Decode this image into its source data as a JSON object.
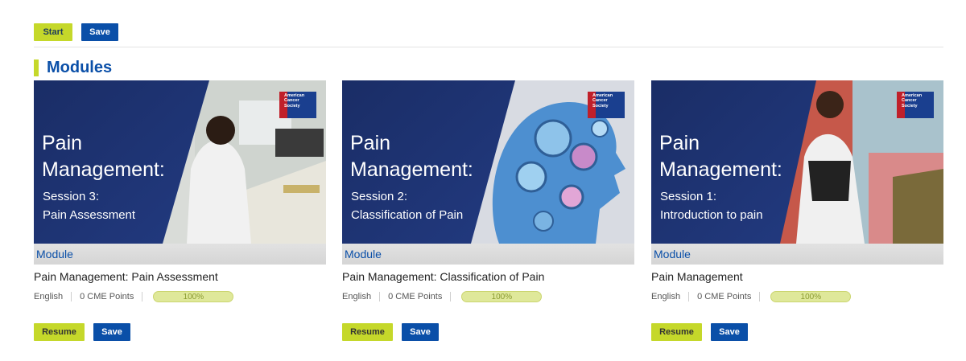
{
  "toolbar": {
    "start_label": "Start",
    "save_label": "Save"
  },
  "section": {
    "title": "Modules"
  },
  "cards": [
    {
      "thumb_title_1": "Pain",
      "thumb_title_2": "Management:",
      "thumb_sub_1": "Session 3:",
      "thumb_sub_2": "Pain Assessment",
      "logo_text": "American Cancer Society",
      "type": "Module",
      "name": "Pain Management: Pain Assessment",
      "language": "English",
      "points": "0 CME Points",
      "progress": "100%",
      "resume_label": "Resume",
      "save_label": "Save"
    },
    {
      "thumb_title_1": "Pain",
      "thumb_title_2": "Management:",
      "thumb_sub_1": "Session 2:",
      "thumb_sub_2": "Classification of Pain",
      "logo_text": "American Cancer Society",
      "type": "Module",
      "name": "Pain Management: Classification of Pain",
      "language": "English",
      "points": "0 CME Points",
      "progress": "100%",
      "resume_label": "Resume",
      "save_label": "Save"
    },
    {
      "thumb_title_1": "Pain",
      "thumb_title_2": "Management:",
      "thumb_sub_1": "Session 1:",
      "thumb_sub_2": "Introduction to pain",
      "logo_text": "American Cancer Society",
      "type": "Module",
      "name": "Pain Management",
      "language": "English",
      "points": "0 CME Points",
      "progress": "100%",
      "resume_label": "Resume",
      "save_label": "Save"
    }
  ],
  "colors": {
    "accent": "#c5d82a",
    "brand_blue": "#0a4fa8",
    "thumb_navy": "#1b2f6b"
  }
}
